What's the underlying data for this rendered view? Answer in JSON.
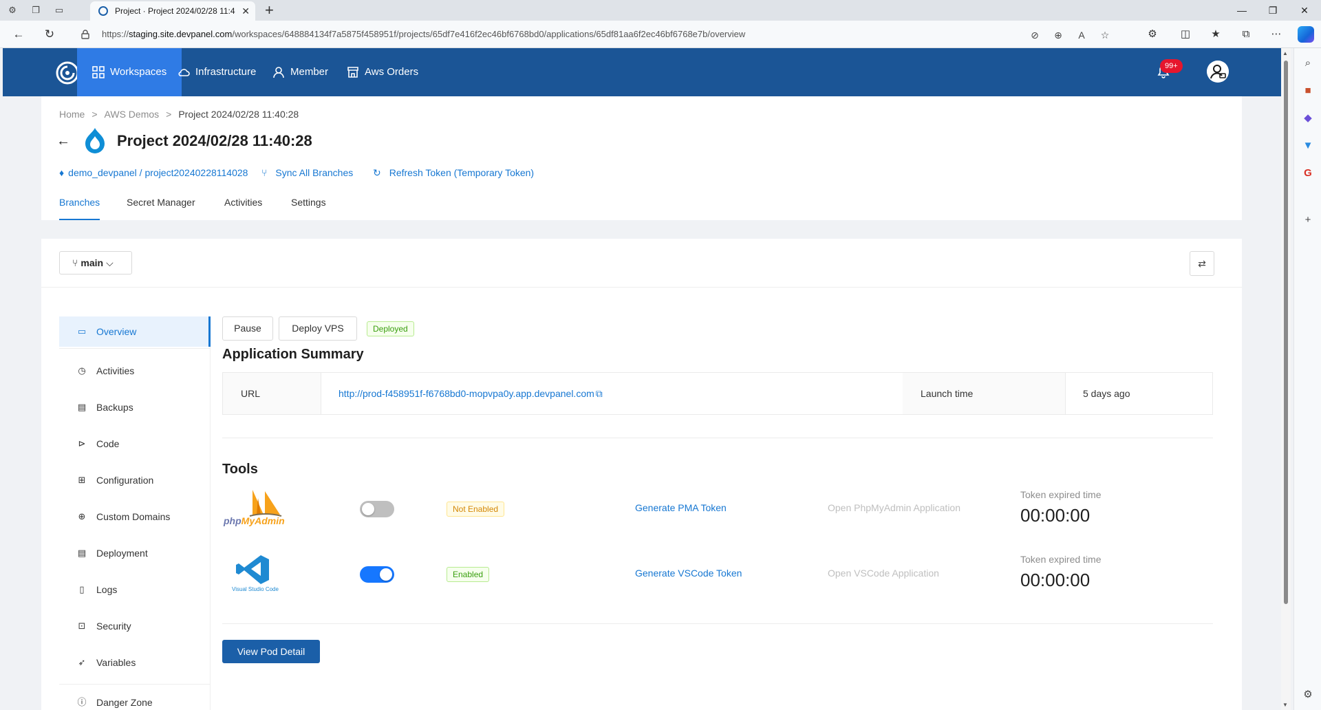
{
  "browser": {
    "tab_title": "Project · Project 2024/02/28 11:4",
    "url_prefix": "https://",
    "url_host": "staging.site.devpanel.com",
    "url_path": "/workspaces/648884134f7a5875f458951f/projects/65df7e416f2ec46bf6768bd0/applications/65df81aa6f2ec46bf6768e7b/overview"
  },
  "appnav": {
    "items": [
      {
        "label": "Workspaces",
        "icon": "grid-icon",
        "active": true
      },
      {
        "label": "Infrastructure",
        "icon": "cloud-icon",
        "active": false
      },
      {
        "label": "Member",
        "icon": "user-icon",
        "active": false
      },
      {
        "label": "Aws Orders",
        "icon": "store-icon",
        "active": false
      }
    ],
    "notifications_badge": "99+"
  },
  "project": {
    "breadcrumb": [
      "Home",
      "AWS Demos",
      "Project 2024/02/28 11:40:28"
    ],
    "title": "Project 2024/02/28 11:40:28",
    "repo_link": "demo_devpanel / project20240228114028",
    "sync_label": "Sync All Branches",
    "refresh_label": "Refresh Token  (Temporary Token)",
    "tabs": [
      "Branches",
      "Secret Manager",
      "Activities",
      "Settings"
    ],
    "active_tab": "Branches"
  },
  "branch": {
    "selected": "main"
  },
  "sidebar": {
    "items": [
      {
        "label": "Overview",
        "icon": "monitor-icon",
        "active": true
      },
      {
        "label": "Activities",
        "icon": "clock-icon",
        "active": false
      },
      {
        "label": "Backups",
        "icon": "archive-icon",
        "active": false
      },
      {
        "label": "Code",
        "icon": "terminal-icon",
        "active": false
      },
      {
        "label": "Configuration",
        "icon": "sliders-icon",
        "active": false
      },
      {
        "label": "Custom Domains",
        "icon": "globe-icon",
        "active": false
      },
      {
        "label": "Deployment",
        "icon": "file-list-icon",
        "active": false
      },
      {
        "label": "Logs",
        "icon": "file-icon",
        "active": false
      },
      {
        "label": "Security",
        "icon": "lock-icon",
        "active": false
      },
      {
        "label": "Variables",
        "icon": "rocket-icon",
        "active": false
      },
      {
        "label": "Danger Zone",
        "icon": "warning-circle-icon",
        "active": false
      }
    ]
  },
  "overview": {
    "pause_label": "Pause",
    "deploy_label": "Deploy VPS",
    "status": "Deployed",
    "summary_title": "Application Summary",
    "url_label": "URL",
    "url_value": "http://prod-f458951f-f6768bd0-mopvpa0y.app.devpanel.com",
    "launch_label": "Launch time",
    "launch_value": "5 days ago",
    "tools_title": "Tools",
    "tools": [
      {
        "name": "phpMyAdmin",
        "logo_text": "phpMyAdmin",
        "enabled": false,
        "status": "Not Enabled",
        "generate_label": "Generate PMA Token",
        "open_label": "Open PhpMyAdmin Application",
        "expired_label": "Token expired time",
        "expired_value": "00:00:00"
      },
      {
        "name": "VSCode",
        "logo_text": "Visual Studio Code",
        "enabled": true,
        "status": "Enabled",
        "generate_label": "Generate VSCode Token",
        "open_label": "Open VSCode Application",
        "expired_label": "Token expired time",
        "expired_value": "00:00:00"
      }
    ],
    "pod_button": "View Pod Detail"
  },
  "colors": {
    "header": "#1b5596",
    "active_nav": "#2f7be5",
    "link": "#1677d2",
    "primary_button": "#1b5fa8"
  }
}
